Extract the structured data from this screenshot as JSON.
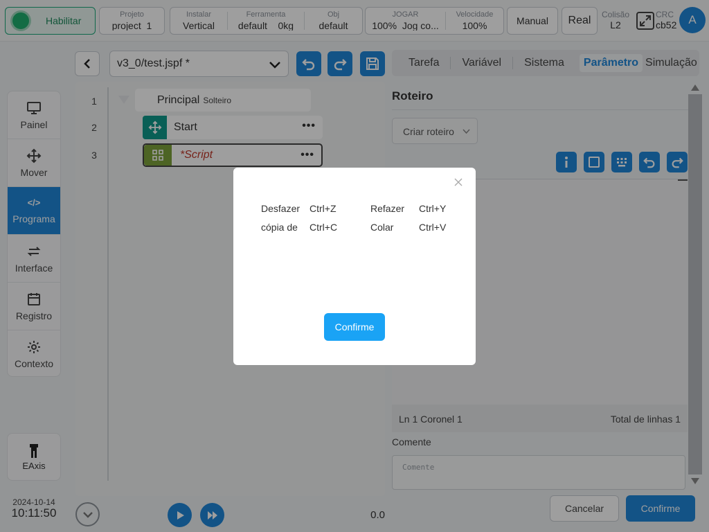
{
  "topbar": {
    "enable_label": "Habilitar",
    "project": {
      "label": "Projeto",
      "value": "project_1"
    },
    "install": {
      "label": "Instalar",
      "value": "Vertical"
    },
    "tool": {
      "label": "Ferramenta",
      "value": "default"
    },
    "tool_weight": "0kg",
    "obj": {
      "label": "Obj",
      "value": "default"
    },
    "jog": {
      "label": "JOGAR",
      "value_pct": "100%",
      "value_text": "Jog co..."
    },
    "speed": {
      "label": "Velocidade",
      "value": "100%"
    },
    "mode_label": "Manual",
    "real_label": "Real",
    "collision": {
      "label": "Colisão",
      "value": "L2"
    },
    "crc": {
      "label": "CRC",
      "value": "cb52"
    },
    "avatar_letter": "A"
  },
  "nav": {
    "items": [
      {
        "label": "Painel"
      },
      {
        "label": "Mover"
      },
      {
        "label": "Programa",
        "code": "</>"
      },
      {
        "label": "Interface"
      },
      {
        "label": "Registro"
      },
      {
        "label": "Contexto"
      }
    ],
    "eaxis_label": "EAxis"
  },
  "datetime": {
    "date": "2024-10-14",
    "time": "10:11:50"
  },
  "editor": {
    "file_name": "v3_0/test.jspf *",
    "lines": [
      "1",
      "2",
      "3"
    ],
    "principal_label": "Principal",
    "principal_sub": "Solteiro",
    "start_label": "Start",
    "script_label": "*Script",
    "dots": "•••",
    "speed_value": "0.0"
  },
  "tabs": [
    "Tarefa",
    "Variável",
    "Sistema",
    "Parâmetro",
    "Simulação"
  ],
  "panel": {
    "title": "Roteiro",
    "create_label": "Criar roteiro",
    "status_left": "Ln 1 Coronel 1",
    "status_right": "Total de linhas 1",
    "comment_label": "Comente",
    "comment_placeholder": "Comente"
  },
  "footer": {
    "cancel_label": "Cancelar",
    "confirm_label": "Confirme"
  },
  "modal": {
    "shortcuts": [
      {
        "action": "Desfazer",
        "keys": "Ctrl+Z",
        "action2": "Refazer",
        "keys2": "Ctrl+Y"
      },
      {
        "action": "cópia de",
        "keys": "Ctrl+C",
        "action2": "Colar",
        "keys2": "Ctrl+V"
      }
    ],
    "confirm_label": "Confirme"
  },
  "colors": {
    "accent": "#1f86d9",
    "enable_green": "#1faf6e",
    "modal_button": "#1aa3f5",
    "script_green": "#7ca23a",
    "move_teal": "#0f9a8c"
  }
}
